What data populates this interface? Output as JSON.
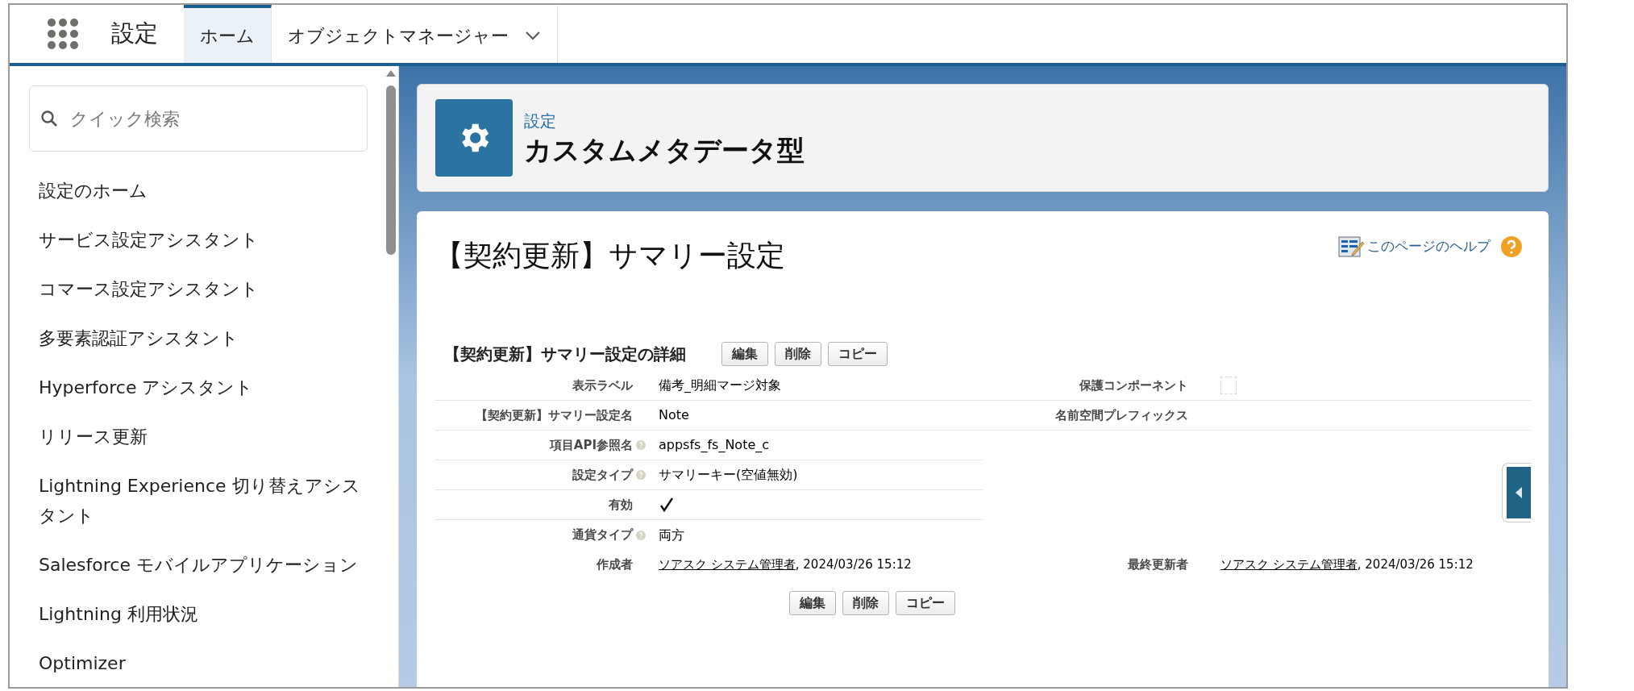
{
  "app_title": "設定",
  "tabs": [
    {
      "label": "ホーム",
      "selected": true,
      "menu": false
    },
    {
      "label": "オブジェクトマネージャー",
      "selected": false,
      "menu": true
    }
  ],
  "sidebar": {
    "search": {
      "placeholder": "クイック検索"
    },
    "items": [
      "設定のホーム",
      "サービス設定アシスタント",
      "コマース設定アシスタント",
      "多要素認証アシスタント",
      "Hyperforce アシスタント",
      "リリース更新",
      "Lightning Experience 切り替えアシスタント",
      "Salesforce モバイルアプリケーション",
      "Lightning 利用状況",
      "Optimizer"
    ]
  },
  "header": {
    "breadcrumb": "設定",
    "title": "カスタムメタデータ型"
  },
  "page": {
    "title": "【契約更新】サマリー設定",
    "help_link": "このページのヘルプ"
  },
  "detail": {
    "title": "【契約更新】サマリー設定の詳細",
    "buttons": [
      "編集",
      "削除",
      "コピー"
    ],
    "fields": [
      {
        "label": "表示ラベル",
        "help": false,
        "kind": "text",
        "value": "備考_明細マージ対象"
      },
      {
        "label": "【契約更新】サマリー設定名",
        "help": false,
        "kind": "text",
        "value": "Note"
      },
      {
        "label": "項目API参照名",
        "help": true,
        "kind": "text",
        "value": "appsfs_fs_Note_c"
      },
      {
        "label": "設定タイプ",
        "help": true,
        "kind": "text",
        "value": "サマリーキー(空値無効)"
      },
      {
        "label": "有効",
        "help": false,
        "kind": "checkbox",
        "checked": true
      },
      {
        "label": "通貨タイプ",
        "help": true,
        "kind": "text",
        "value": "両方"
      }
    ],
    "side_fields": [
      {
        "label": "保護コンポーネント",
        "kind": "checkbox",
        "checked": false
      },
      {
        "label": "名前空間プレフィックス",
        "kind": "text"
      }
    ],
    "audit": [
      {
        "label": "作成者",
        "user": "ソアスク システム管理者",
        "timestamp": ", 2024/03/26 15:12"
      },
      {
        "label": "最終更新者",
        "user": "ソアスク システム管理者",
        "timestamp": ", 2024/03/26 15:12"
      }
    ],
    "bottom_buttons": [
      "編集",
      "削除",
      "コピー"
    ]
  }
}
